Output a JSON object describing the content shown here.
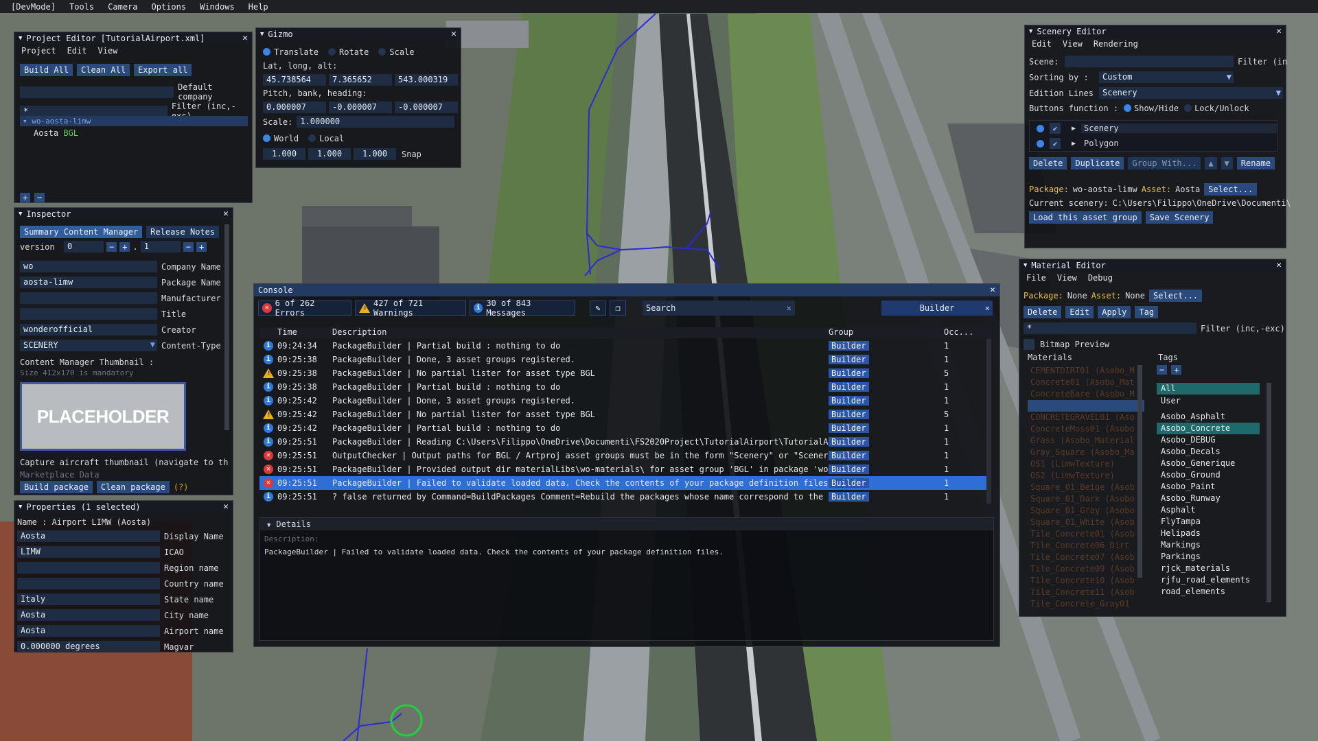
{
  "menubar": [
    "[DevMode]",
    "Tools",
    "Camera",
    "Options",
    "Windows",
    "Help"
  ],
  "project_editor": {
    "title": "Project Editor [TutorialAirport.xml]",
    "menu": [
      "Project",
      "Edit",
      "View"
    ],
    "buttons": [
      "Build All",
      "Clean All",
      "Export all"
    ],
    "default_company_label": "Default company",
    "filter_value": "*",
    "filter_label": "Filter (inc,-exc)",
    "tree_root": "wo-aosta-limw",
    "tree_child_name": "Aosta",
    "tree_child_tag": "BGL",
    "add_btn": "+",
    "remove_btn": "−"
  },
  "gizmo": {
    "title": "Gizmo",
    "modes": [
      "Translate",
      "Rotate",
      "Scale"
    ],
    "latlong_label": "Lat, long, alt:",
    "lat": "45.738564",
    "long": "7.365652",
    "alt": "543.000319",
    "pbh_label": "Pitch, bank, heading:",
    "pitch": "0.000007",
    "bank": "-0.000007",
    "heading": "-0.000007",
    "scale_label": "Scale:",
    "scale": "1.000000",
    "space": [
      "World",
      "Local"
    ],
    "snap_values": [
      "1.000",
      "1.000",
      "1.000"
    ],
    "snap_label": "Snap"
  },
  "inspector": {
    "title": "Inspector",
    "tabs": [
      "Summary Content Manager",
      "Release Notes"
    ],
    "version_label": "version",
    "version_major": "0",
    "version_minor": "1",
    "fields": [
      {
        "value": "wo",
        "label": "Company Name"
      },
      {
        "value": "aosta-limw",
        "label": "Package Name"
      },
      {
        "value": "",
        "label": "Manufacturer"
      },
      {
        "value": "",
        "label": "Title"
      },
      {
        "value": "wonderofficial",
        "label": "Creator"
      },
      {
        "value": "SCENERY",
        "label": "Content-Type"
      }
    ],
    "thumb_label": "Content Manager Thumbnail :",
    "thumb_hint": "Size 412x170 is mandatory",
    "placeholder": "PLACEHOLDER",
    "capture_text": "Capture aircraft thumbnail (navigate to th",
    "marketplace": "Marketplace Data",
    "build_btn": "Build package",
    "clean_btn": "Clean package",
    "help": "(?)"
  },
  "properties": {
    "title": "Properties (1 selected)",
    "name_line": "Name : Airport LIMW (Aosta)",
    "fields": [
      {
        "value": "Aosta",
        "label": "Display Name"
      },
      {
        "value": "LIMW",
        "label": "ICAO"
      },
      {
        "value": "",
        "label": "Region name"
      },
      {
        "value": "",
        "label": "Country name"
      },
      {
        "value": "Italy",
        "label": "State name"
      },
      {
        "value": "Aosta",
        "label": "City name"
      },
      {
        "value": "Aosta",
        "label": "Airport name"
      },
      {
        "value": "0.000000 degrees",
        "label": "Magvar"
      }
    ]
  },
  "console": {
    "title": "Console",
    "errors": "6 of 262 Errors",
    "warnings": "427 of 721 Warnings",
    "messages": "30 of 843 Messages",
    "search_placeholder": "Search",
    "filter_value": "Builder",
    "columns": [
      "Time",
      "Description",
      "Group",
      "Occ..."
    ],
    "rows": [
      {
        "type": "info",
        "time": "09:24:34",
        "desc": "PackageBuilder | Partial build : nothing to do",
        "group": "Builder",
        "occ": "1"
      },
      {
        "type": "info",
        "time": "09:25:38",
        "desc": "PackageBuilder | Done, 3 asset groups registered.",
        "group": "Builder",
        "occ": "1"
      },
      {
        "type": "warn",
        "time": "09:25:38",
        "desc": "PackageBuilder | No partial lister for asset type BGL",
        "group": "Builder",
        "occ": "5"
      },
      {
        "type": "info",
        "time": "09:25:38",
        "desc": "PackageBuilder | Partial build : nothing to do",
        "group": "Builder",
        "occ": "1"
      },
      {
        "type": "info",
        "time": "09:25:42",
        "desc": "PackageBuilder | Done, 3 asset groups registered.",
        "group": "Builder",
        "occ": "1"
      },
      {
        "type": "warn",
        "time": "09:25:42",
        "desc": "PackageBuilder | No partial lister for asset type BGL",
        "group": "Builder",
        "occ": "5"
      },
      {
        "type": "info",
        "time": "09:25:42",
        "desc": "PackageBuilder | Partial build : nothing to do",
        "group": "Builder",
        "occ": "1"
      },
      {
        "type": "info",
        "time": "09:25:51",
        "desc": "PackageBuilder | Reading C:\\Users\\Filippo\\OneDrive\\Documenti\\FS2020Project\\TutorialAirport\\TutorialAirpo",
        "group": "Builder",
        "occ": "1"
      },
      {
        "type": "err",
        "time": "09:25:51",
        "desc": "OutputChecker | Output paths for BGL / Artproj asset groups must be in the form \"Scenery\" or \"Scenery\\<",
        "group": "Builder",
        "occ": "1"
      },
      {
        "type": "err",
        "time": "09:25:51",
        "desc": "PackageBuilder | Provided output dir materialLibs\\wo-materials\\ for asset group 'BGL' in package 'wo-ao",
        "group": "Builder",
        "occ": "1"
      },
      {
        "type": "err",
        "time": "09:25:51",
        "desc": "PackageBuilder | Failed to validate loaded data. Check the contents of your package definition files.",
        "group": "Builder",
        "occ": "1",
        "selected": true
      },
      {
        "type": "info",
        "time": "09:25:51",
        "desc": "? false returned by Command=BuildPackages Comment=Rebuild the packages whose name correspond to the giv",
        "group": "Builder",
        "occ": "1"
      }
    ],
    "details_title": "Details",
    "details_label": "Description:",
    "details_text": "PackageBuilder | Failed to validate loaded data. Check the contents of your package definition files."
  },
  "scenery_editor": {
    "title": "Scenery Editor",
    "menu": [
      "Edit",
      "View",
      "Rendering"
    ],
    "scene_label": "Scene:",
    "filter_label": "Filter (in",
    "sorting_label": "Sorting by :",
    "sorting_value": "Custom",
    "edition_label": "Edition Lines of",
    "edition_value": "Scenery",
    "buttons_label": "Buttons function :",
    "showhide": "Show/Hide",
    "lockunlock": "Lock/Unlock",
    "items": [
      "Scenery",
      "Polygon"
    ],
    "actions": [
      "Delete",
      "Duplicate",
      "Group With...",
      "Rename"
    ],
    "package_label": "Package:",
    "package_value": "wo-aosta-limw",
    "asset_label": "Asset:",
    "asset_value": "Aosta",
    "select_btn": "Select...",
    "current_label": "Current scenery:",
    "current_value": "C:\\Users\\Filippo\\OneDrive\\Documenti\\",
    "load_btn": "Load this asset group",
    "save_btn": "Save Scenery"
  },
  "material_editor": {
    "title": "Material Editor",
    "menu": [
      "File",
      "View",
      "Debug"
    ],
    "package_label": "Package:",
    "package_value": "None",
    "asset_label": "Asset:",
    "asset_value": "None",
    "select_btn": "Select...",
    "actions": [
      "Delete",
      "Edit",
      "Apply",
      "Tag"
    ],
    "filter_value": "*",
    "filter_label": "Filter (inc,-exc)",
    "bitmap_preview": "Bitmap Preview",
    "materials_label": "Materials",
    "tags_label": "Tags",
    "materials": [
      "CEMENTDIRT01 (Asobo_M",
      "Concrete01 (Asobo_Mat",
      "ConcreteBare (Asobo_M",
      "",
      "CONCRETEGRAVEL01 (Aso",
      "ConcreteMoss01 (Asobo",
      "Grass (Asobo_Material",
      "Gray_Square (Asobo_Ma",
      "OS1 (LimwTexture)",
      "OS2 (LimwTexture)",
      "Square_01_Beige (Asob",
      "Square_01_Dark (Asobo",
      "Square_01_Gray (Asobo",
      "Square_01_White (Asob",
      "Tile_Concrete01 (Asob",
      "Tile_Concrete06_Dirt",
      "Tile_Concrete07 (Asob",
      "Tile_Concrete09 (Asob",
      "Tile_Concrete10 (Asob",
      "Tile_Concrete11 (Asob",
      "Tile_Concrete_Gray01"
    ],
    "tags": [
      "All",
      "User",
      "Asobo_Asphalt",
      "Asobo_Concrete",
      "Asobo_DEBUG",
      "Asobo_Decals",
      "Asobo_Generique",
      "Asobo_Ground",
      "Asobo_Paint",
      "Asobo_Runway",
      "Asphalt",
      "FlyTampa",
      "Helipads",
      "Markings",
      "Parkings",
      "rjck_materials",
      "rjfu_road_elements",
      "road_elements"
    ]
  }
}
